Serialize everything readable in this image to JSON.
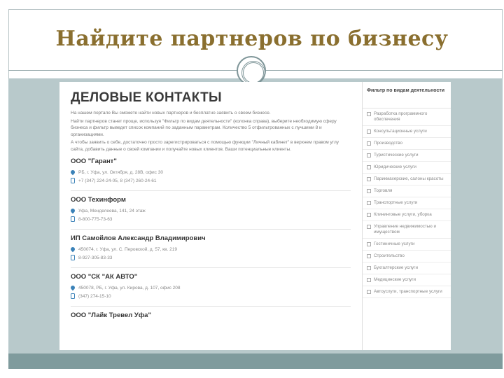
{
  "slide": {
    "title": "Найдите партнеров по бизнесу"
  },
  "site": {
    "heading": "ДЕЛОВЫЕ КОНТАКТЫ",
    "intro": [
      "На нашем портале Вы сможете найти новых партнеров и бесплатно заявить о своем бизнесе.",
      "Найти партнеров станет проще, используя \"Фильтр по видам деятельности\" (колонка справа), выберите необходимую сферу бизнеса и фильтр выведет список компаний по заданным параметрам. Количество 5 отфильтрованных с лучшими 8 и организациями.",
      "А чтобы заявить о себе, достаточно просто зарегистрироваться с помощью функции \"Личный кабинет\" в верхнем правом углу сайта, добавить данные о своей компании и получайте новых клиентов. Ваши потенциальные клиенты."
    ],
    "companies": [
      {
        "name": "ООО \"Гарант\"",
        "address": "РБ, г. Уфа, ул. Октября, д. 28В, офис 30",
        "phone": "+7 (347) 224-24-05, 8 (347) 260-24-61"
      },
      {
        "name": "ООО Техинформ",
        "address": "Уфа, Менделеева, 141, 24 этаж",
        "phone": "8-800-775-73-63"
      },
      {
        "name": "ИП Самойлов Александр Владимирович",
        "address": "450074, г. Уфа, ул. С. Перовской, д. 57, кв. 219",
        "phone": "8-927-305-83-33"
      },
      {
        "name": "ООО \"СК \"АК АВТО\"",
        "address": "450078, РБ, г. Уфа, ул. Кирова, д. 107, офис 208",
        "phone": "(347) 274-15-10"
      },
      {
        "name": "ООО \"Лайк Тревел Уфа\"",
        "address": "",
        "phone": ""
      }
    ]
  },
  "filter": {
    "title": "Фильтр по видам деятельности",
    "items": [
      "Разработка программного обеспечения",
      "Консультационные услуги",
      "Производство",
      "Туристические услуги",
      "Юридические услуги",
      "Парикмахерские, салоны красоты",
      "Торговля",
      "Транспортные услуги",
      "Клининговые услуги, уборка",
      "Управление недвижимостью и имуществом",
      "Гостиничные услуги",
      "Строительство",
      "Бухгалтерские услуги",
      "Медицинские услуги",
      "Автоуслуги, транспортные услуги"
    ]
  }
}
